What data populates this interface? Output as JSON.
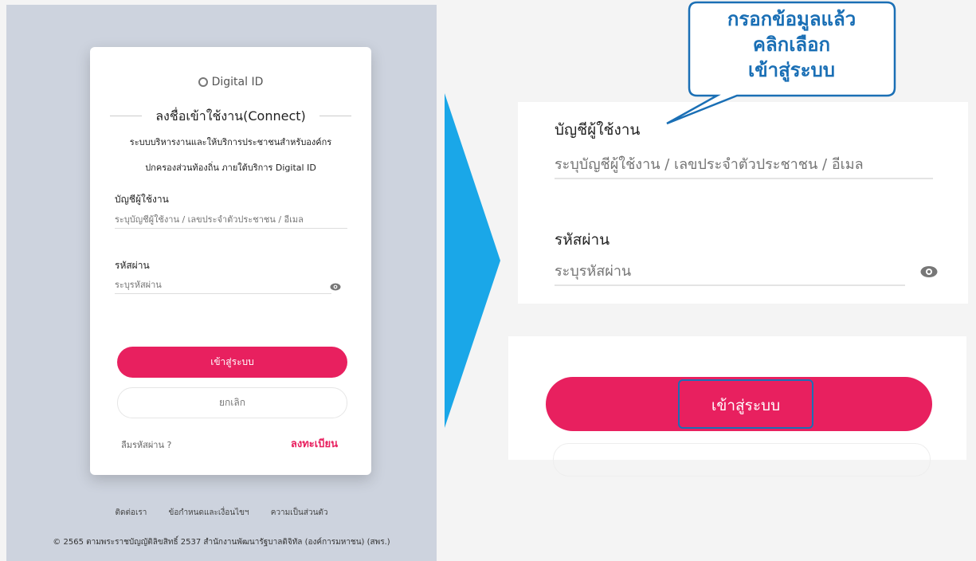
{
  "login": {
    "logo_text": "Digital ID",
    "title": "ลงชื่อเข้าใช้งาน(Connect)",
    "subtitle_line1": "ระบบบริหารงานและให้บริการประชาชนสำหรับองค์กร",
    "subtitle_line2": "ปกครองส่วนท้องถิ่น ภายใต้บริการ Digital ID",
    "username_label": "บัญชีผู้ใช้งาน",
    "username_placeholder": "ระบุบัญชีผู้ใช้งาน / เลขประจำตัวประชาชน / อีเมล",
    "password_label": "รหัสผ่าน",
    "password_placeholder": "ระบุรหัสผ่าน",
    "login_button": "เข้าสู่ระบบ",
    "cancel_button": "ยกเลิก",
    "forgot_password": "ลืมรหัสผ่าน ?",
    "register": "ลงทะเบียน"
  },
  "footer": {
    "links": [
      "ติดต่อเรา",
      "ข้อกำหนดและเงื่อนไขฯ",
      "ความเป็นส่วนตัว"
    ],
    "copyright": "© 2565 ตามพระราชบัญญัติลิขสิทธิ์ 2537 สำนักงานพัฒนารัฐบาลดิจิทัล (องค์การมหาชน) (สพร.)"
  },
  "callout": {
    "line1": "กรอกข้อมูลแล้ว",
    "line2": "คลิกเลือก",
    "line3": "เข้าสู่ระบบ"
  },
  "zoom": {
    "username_label": "บัญชีผู้ใช้งาน",
    "username_placeholder": "ระบุบัญชีผู้ใช้งาน / เลขประจำตัวประชาชน / อีเมล",
    "password_label": "รหัสผ่าน",
    "password_placeholder": "ระบุรหัสผ่าน",
    "login_button": "เข้าสู่ระบบ"
  },
  "colors": {
    "primary": "#e8205f",
    "callout": "#1a6fb5",
    "arrow": "#1aa7e8",
    "background": "#cdd3de"
  }
}
